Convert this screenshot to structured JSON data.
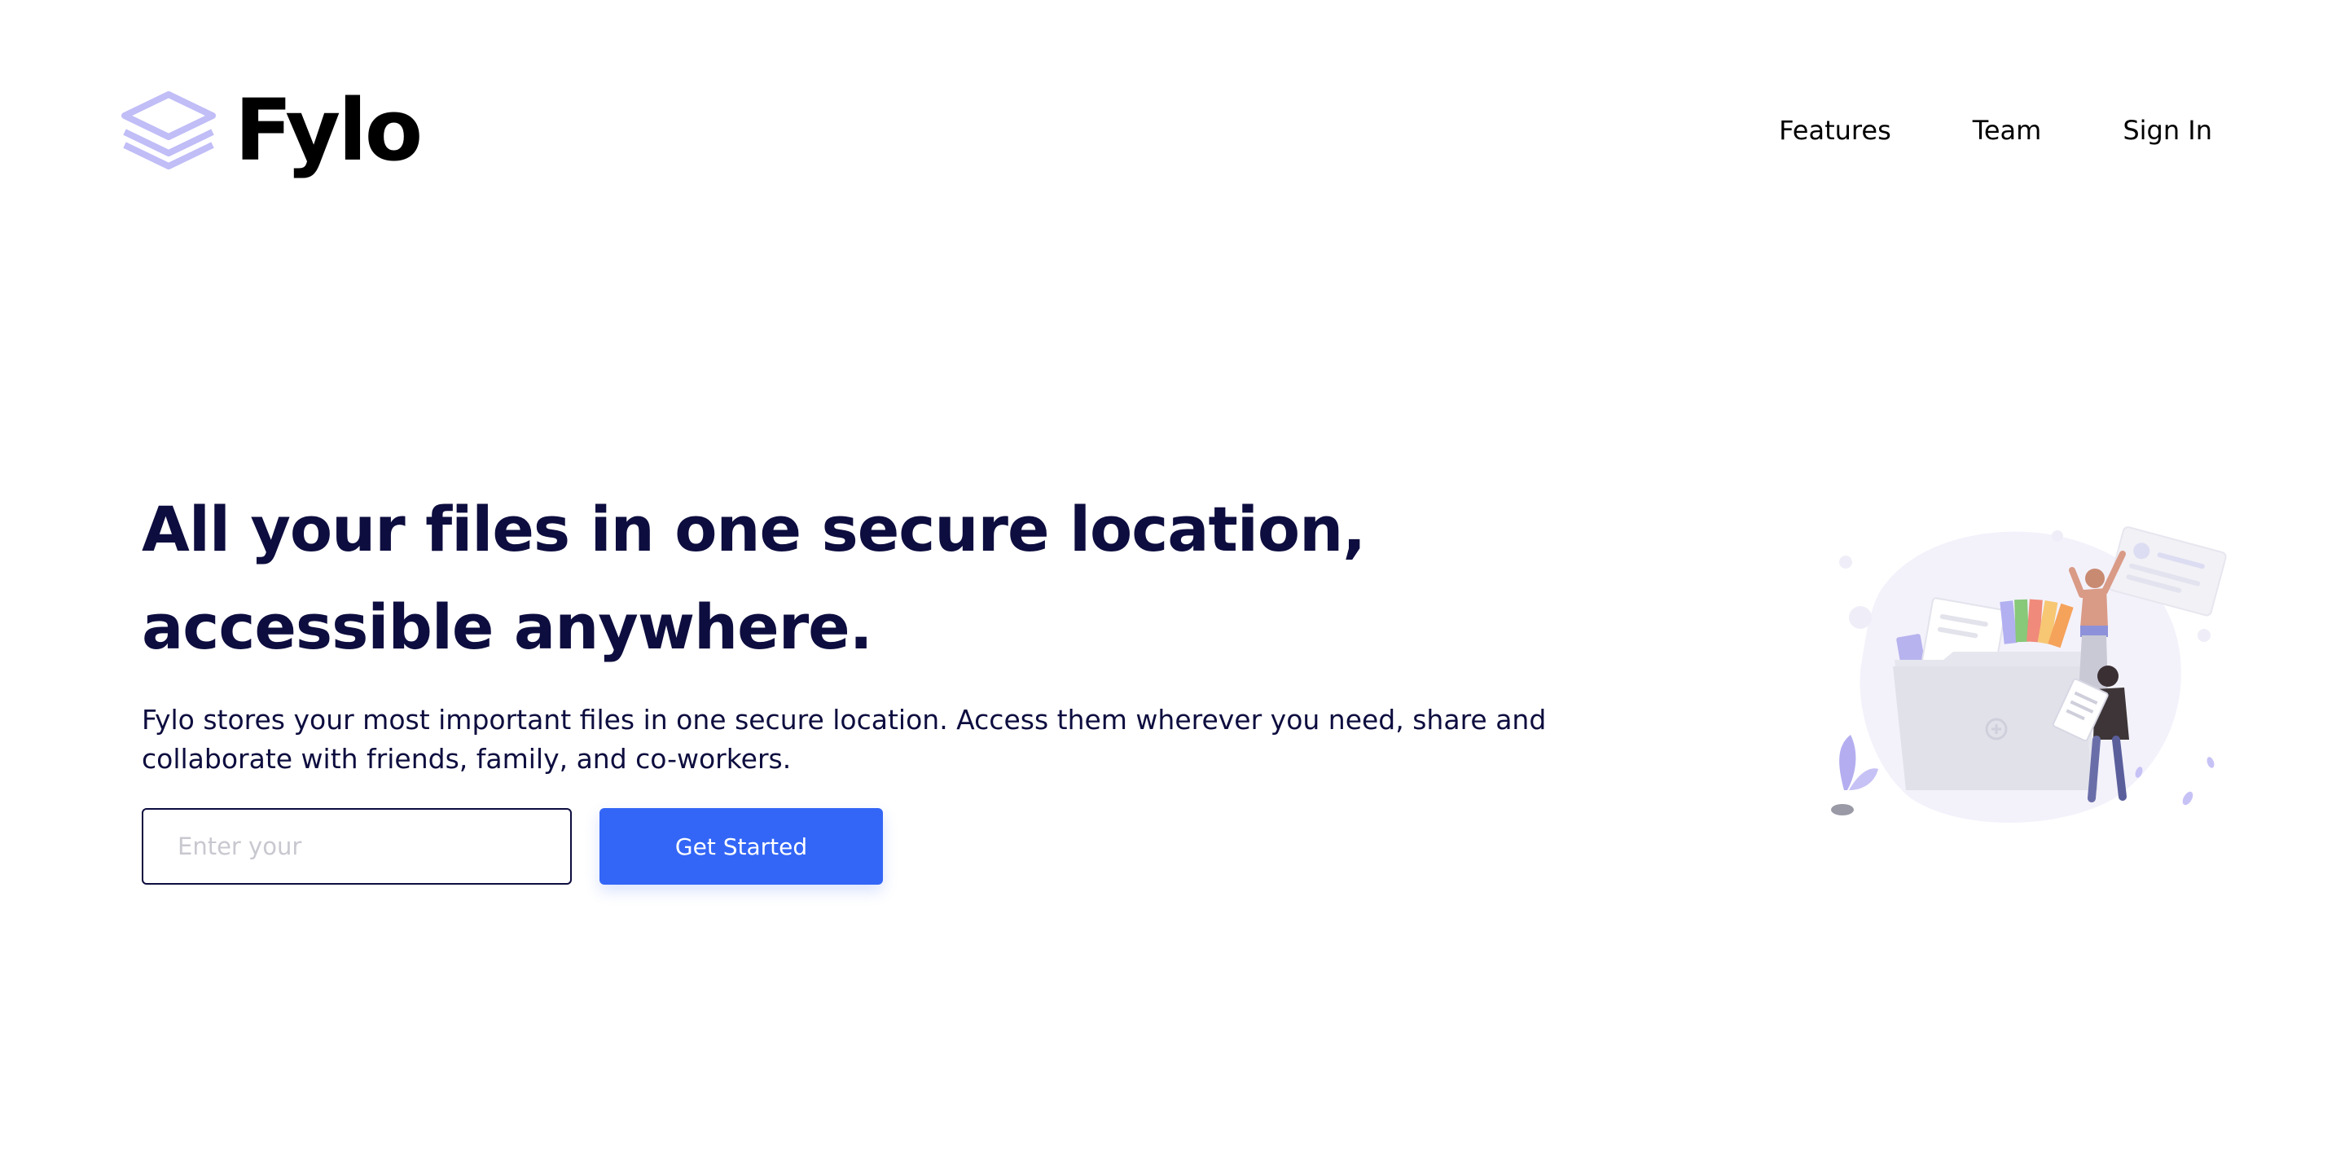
{
  "brand": {
    "name": "Fylo",
    "icon": "stacked-layers-icon",
    "icon_color": "#c0bdf7"
  },
  "nav": {
    "items": [
      {
        "label": "Features"
      },
      {
        "label": "Team"
      },
      {
        "label": "Sign In"
      }
    ]
  },
  "hero": {
    "title": "All your files in one secure location, accessible anywhere.",
    "description": "Fylo stores your most important files in one secure location. Access them wherever you need, share and collaborate with friends, family, and co-workers.",
    "email_placeholder": "Enter your",
    "email_value": "",
    "cta_label": "Get Started",
    "illustration": "people-organizing-files-illustration"
  },
  "colors": {
    "heading": "#0d0d3f",
    "accent": "#3366f6",
    "logo_mark": "#c0bdf7"
  }
}
